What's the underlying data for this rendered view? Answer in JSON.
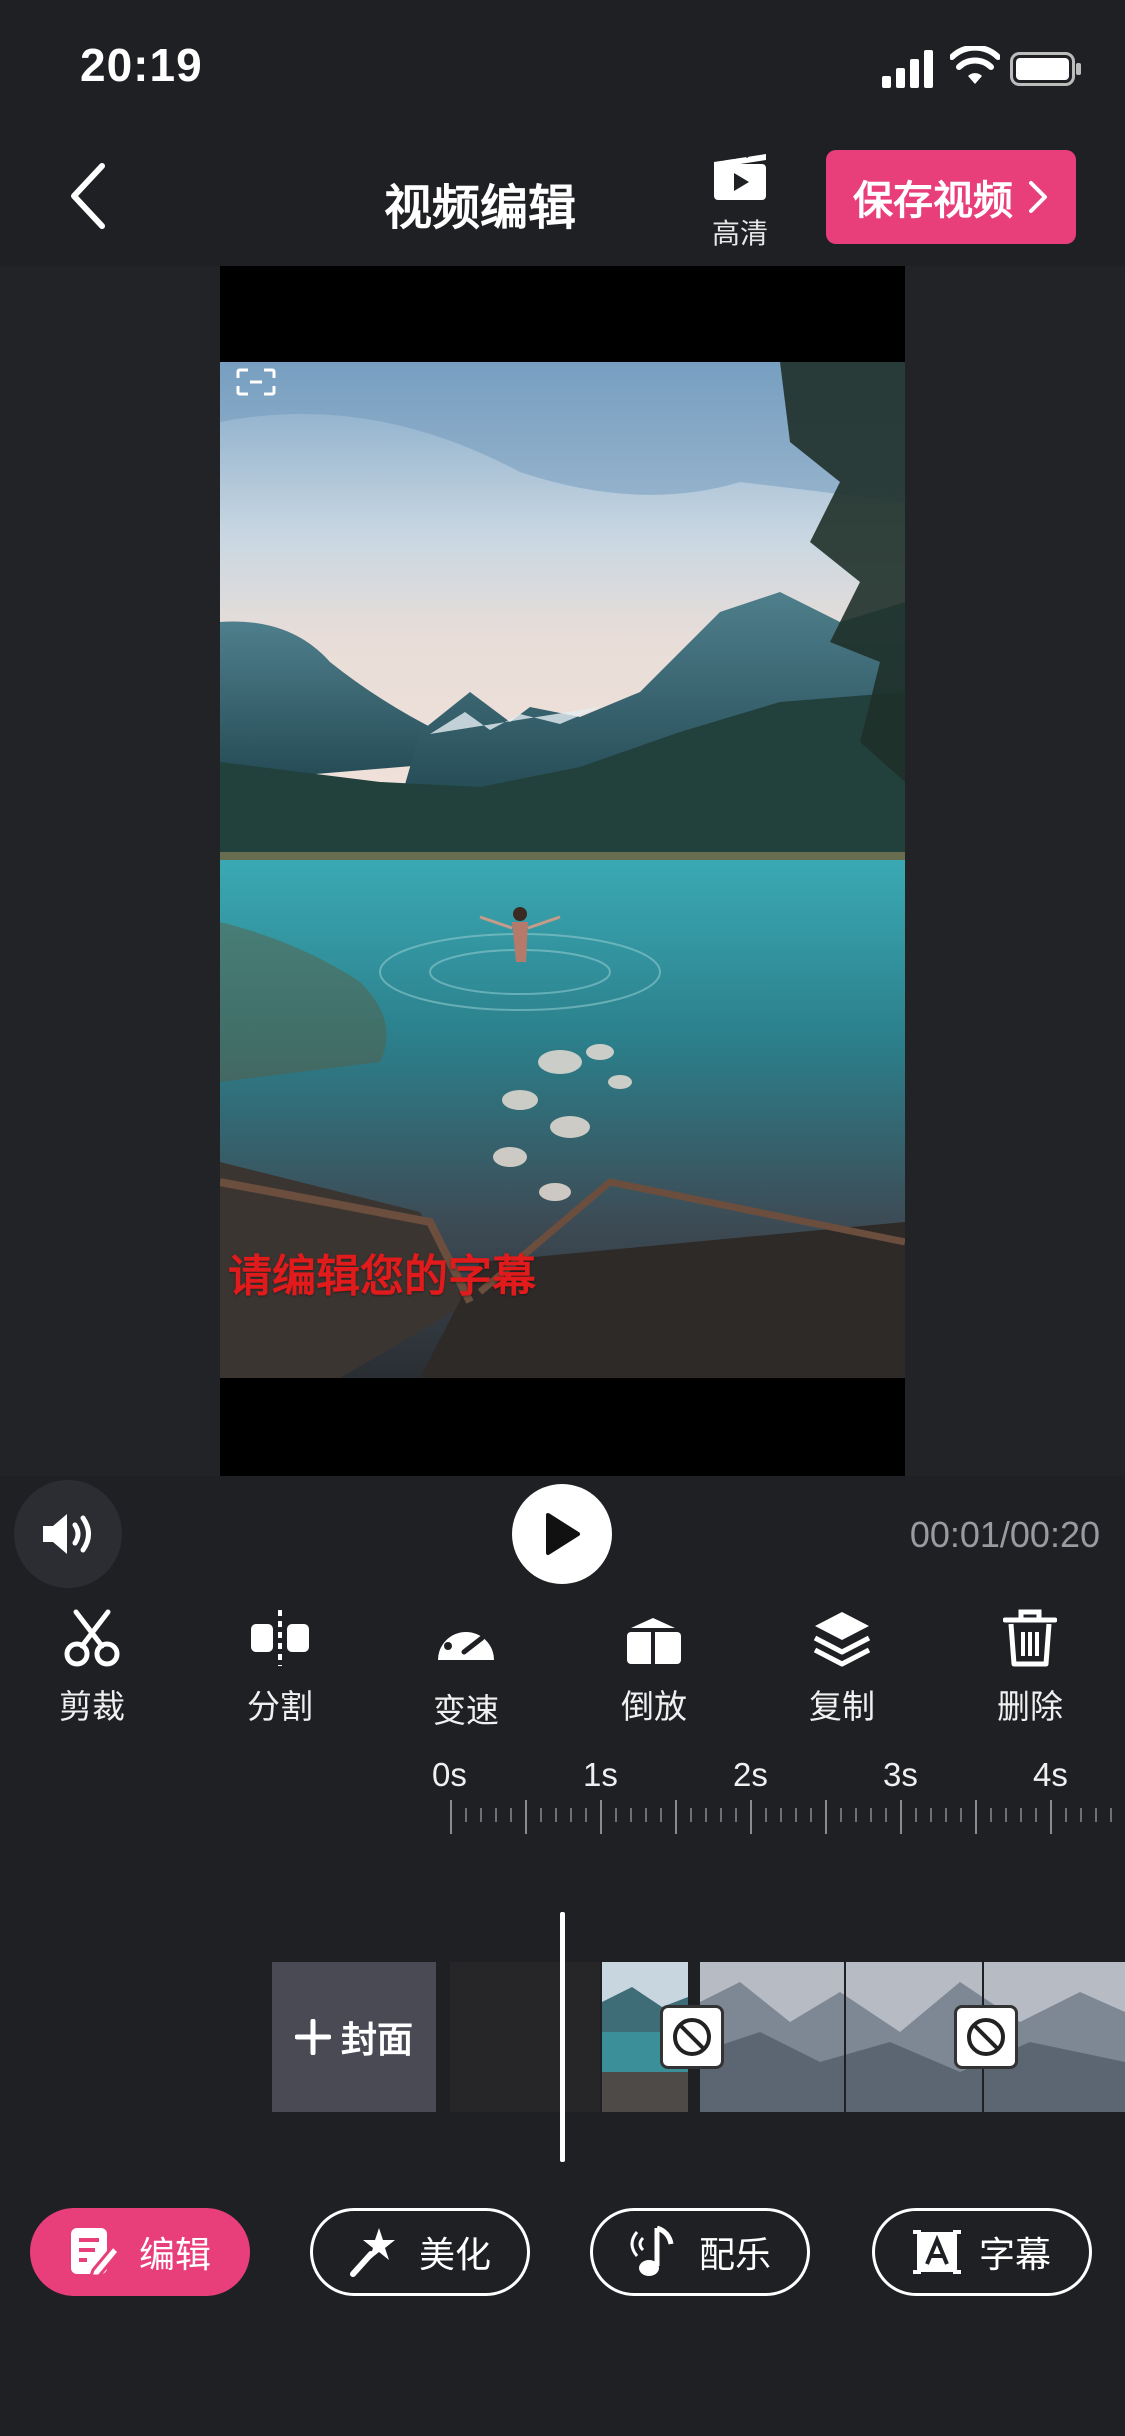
{
  "status": {
    "time": "20:19"
  },
  "header": {
    "title": "视频编辑",
    "hd_label": "高清",
    "save_label": "保存视频"
  },
  "video": {
    "subtitle": "请编辑您的字幕"
  },
  "playback": {
    "time": "00:01/00:20"
  },
  "tools": [
    {
      "label": "剪裁",
      "icon": "scissors-icon"
    },
    {
      "label": "分割",
      "icon": "split-icon"
    },
    {
      "label": "变速",
      "icon": "speed-gauge-icon"
    },
    {
      "label": "倒放",
      "icon": "reverse-icon"
    },
    {
      "label": "复制",
      "icon": "layers-copy-icon"
    },
    {
      "label": "删除",
      "icon": "trash-icon"
    }
  ],
  "ruler": {
    "ticks": [
      "0s",
      "1s",
      "2s",
      "3s",
      "4s"
    ]
  },
  "timeline": {
    "cover_label": "封面"
  },
  "tabs": [
    {
      "label": "编辑",
      "icon": "edit-note-icon",
      "active": true
    },
    {
      "label": "美化",
      "icon": "magic-wand-icon",
      "active": false
    },
    {
      "label": "配乐",
      "icon": "music-note-icon",
      "active": false
    },
    {
      "label": "字幕",
      "icon": "subtitle-text-icon",
      "active": false
    }
  ],
  "colors": {
    "accent": "#e83e7a",
    "background": "#1f2024",
    "subtitle": "#e11b1b"
  }
}
